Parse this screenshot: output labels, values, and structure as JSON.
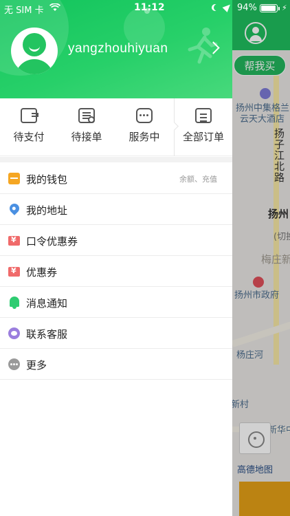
{
  "status_bar": {
    "carrier": "无 SIM 卡",
    "time": "11:12",
    "battery_percent": "94%",
    "battery_level": 0.94
  },
  "profile": {
    "username": "yangzhouhiyuan"
  },
  "orders": [
    {
      "label": "待支付",
      "icon": "wallet-icon"
    },
    {
      "label": "待接单",
      "icon": "receipt-clock-icon"
    },
    {
      "label": "服务中",
      "icon": "service-dots-icon"
    },
    {
      "label": "全部订单",
      "icon": "order-list-icon"
    }
  ],
  "menu": [
    {
      "label": "我的钱包",
      "icon": "wallet-icon",
      "hint": "余额、充值",
      "color": "#f5a623"
    },
    {
      "label": "我的地址",
      "icon": "location-pin-icon",
      "hint": "",
      "color": "#4a90e2"
    },
    {
      "label": "口令优惠券",
      "icon": "coupon-icon",
      "hint": "",
      "color": "#f06a6a"
    },
    {
      "label": "优惠券",
      "icon": "coupon-icon",
      "hint": "",
      "color": "#f06a6a"
    },
    {
      "label": "消息通知",
      "icon": "bell-icon",
      "hint": "",
      "color": "#2ecc71"
    },
    {
      "label": "联系客服",
      "icon": "customer-service-icon",
      "hint": "",
      "color": "#9b7ede"
    },
    {
      "label": "更多",
      "icon": "more-icon",
      "hint": "",
      "color": "#9a9a9a"
    }
  ],
  "map": {
    "help_buy_button": "帮我买",
    "labels": {
      "hotel": "扬州中集格兰",
      "hotel2": "云天大酒店",
      "road": "扬子江北路",
      "district": "扬州",
      "switch": "(切换",
      "area": "梅庄新",
      "gov": "扬州市政府",
      "river": "杨庄河",
      "village": "新村",
      "xinhua": "新华中",
      "bottom": "高德地图"
    }
  },
  "colors": {
    "brand_green": "#1fbf5f",
    "order_bar": "#e5a017"
  }
}
